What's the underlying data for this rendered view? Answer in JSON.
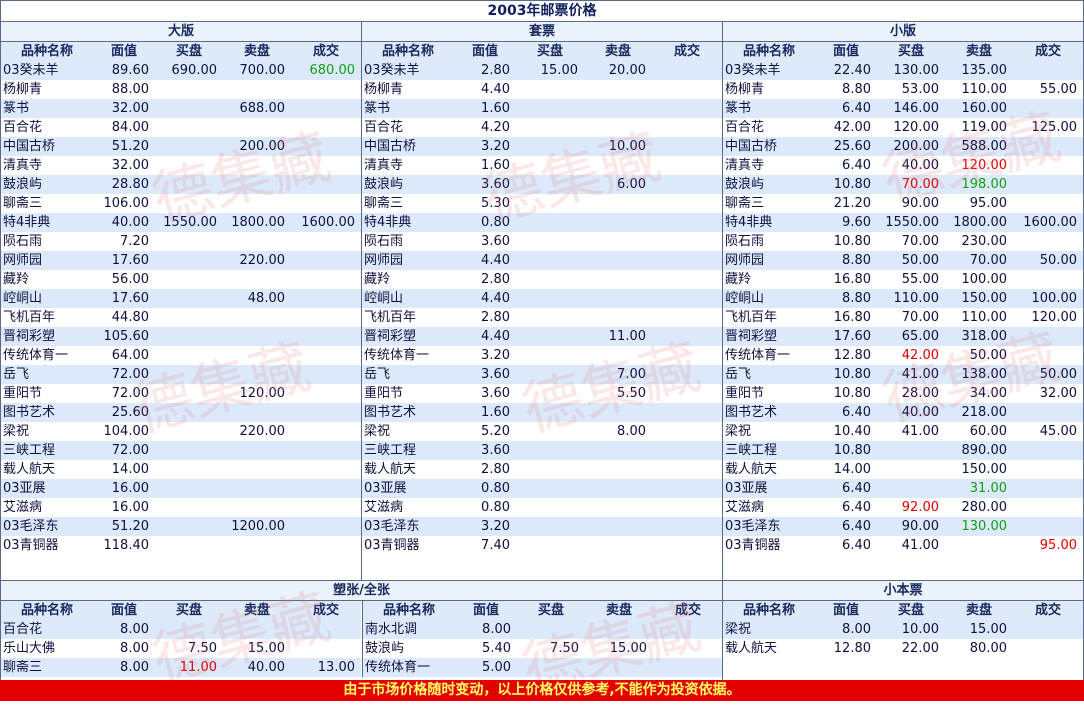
{
  "title": "2003年邮票价格",
  "columns": [
    "品种名称",
    "面值",
    "买盘",
    "卖盘",
    "成交"
  ],
  "panels": {
    "dab": {
      "title": "大版",
      "rows": [
        [
          "03癸未羊",
          "89.60",
          "690.00",
          "700.00",
          "680.00"
        ],
        [
          "杨柳青",
          "88.00",
          "",
          "",
          ""
        ],
        [
          "篆书",
          "32.00",
          "",
          "688.00",
          ""
        ],
        [
          "百合花",
          "84.00",
          "",
          "",
          ""
        ],
        [
          "中国古桥",
          "51.20",
          "",
          "200.00",
          ""
        ],
        [
          "清真寺",
          "32.00",
          "",
          "",
          ""
        ],
        [
          "鼓浪屿",
          "28.80",
          "",
          "",
          ""
        ],
        [
          "聊斋三",
          "106.00",
          "",
          "",
          ""
        ],
        [
          "特4非典",
          "40.00",
          "1550.00",
          "1800.00",
          "1600.00"
        ],
        [
          "陨石雨",
          "7.20",
          "",
          "",
          ""
        ],
        [
          "网师园",
          "17.60",
          "",
          "220.00",
          ""
        ],
        [
          "藏羚",
          "56.00",
          "",
          "",
          ""
        ],
        [
          "崆峒山",
          "17.60",
          "",
          "48.00",
          ""
        ],
        [
          "飞机百年",
          "44.80",
          "",
          "",
          ""
        ],
        [
          "晋祠彩塑",
          "105.60",
          "",
          "",
          ""
        ],
        [
          "传统体育一",
          "64.00",
          "",
          "",
          ""
        ],
        [
          "岳飞",
          "72.00",
          "",
          "",
          ""
        ],
        [
          "重阳节",
          "72.00",
          "",
          "120.00",
          ""
        ],
        [
          "图书艺术",
          "25.60",
          "",
          "",
          ""
        ],
        [
          "梁祝",
          "104.00",
          "",
          "220.00",
          ""
        ],
        [
          "三峡工程",
          "72.00",
          "",
          "",
          ""
        ],
        [
          "载人航天",
          "14.00",
          "",
          "",
          ""
        ],
        [
          "03亚展",
          "16.00",
          "",
          "",
          ""
        ],
        [
          "艾滋病",
          "16.00",
          "",
          "",
          ""
        ],
        [
          "03毛泽东",
          "51.20",
          "",
          "1200.00",
          ""
        ],
        [
          "03青铜器",
          "118.40",
          "",
          "",
          ""
        ]
      ]
    },
    "taopiao": {
      "title": "套票",
      "rows": [
        [
          "03癸未羊",
          "2.80",
          "15.00",
          "20.00",
          ""
        ],
        [
          "杨柳青",
          "4.40",
          "",
          "",
          ""
        ],
        [
          "篆书",
          "1.60",
          "",
          "",
          ""
        ],
        [
          "百合花",
          "4.20",
          "",
          "",
          ""
        ],
        [
          "中国古桥",
          "3.20",
          "",
          "10.00",
          ""
        ],
        [
          "清真寺",
          "1.60",
          "",
          "",
          ""
        ],
        [
          "鼓浪屿",
          "3.60",
          "",
          "6.00",
          ""
        ],
        [
          "聊斋三",
          "5.30",
          "",
          "",
          ""
        ],
        [
          "特4非典",
          "0.80",
          "",
          "",
          ""
        ],
        [
          "陨石雨",
          "3.60",
          "",
          "",
          ""
        ],
        [
          "网师园",
          "4.40",
          "",
          "",
          ""
        ],
        [
          "藏羚",
          "2.80",
          "",
          "",
          ""
        ],
        [
          "崆峒山",
          "4.40",
          "",
          "",
          ""
        ],
        [
          "飞机百年",
          "2.80",
          "",
          "",
          ""
        ],
        [
          "晋祠彩塑",
          "4.40",
          "",
          "11.00",
          ""
        ],
        [
          "传统体育一",
          "3.20",
          "",
          "",
          ""
        ],
        [
          "岳飞",
          "3.60",
          "",
          "7.00",
          ""
        ],
        [
          "重阳节",
          "3.60",
          "",
          "5.50",
          ""
        ],
        [
          "图书艺术",
          "1.60",
          "",
          "",
          ""
        ],
        [
          "梁祝",
          "5.20",
          "",
          "8.00",
          ""
        ],
        [
          "三峡工程",
          "3.60",
          "",
          "",
          ""
        ],
        [
          "载人航天",
          "2.80",
          "",
          "",
          ""
        ],
        [
          "03亚展",
          "0.80",
          "",
          "",
          ""
        ],
        [
          "艾滋病",
          "0.80",
          "",
          "",
          ""
        ],
        [
          "03毛泽东",
          "3.20",
          "",
          "",
          ""
        ],
        [
          "03青铜器",
          "7.40",
          "",
          "",
          ""
        ]
      ]
    },
    "xiaob": {
      "title": "小版",
      "rows": [
        [
          "03癸未羊",
          "22.40",
          "130.00",
          "135.00",
          ""
        ],
        [
          "杨柳青",
          "8.80",
          "53.00",
          "110.00",
          "55.00"
        ],
        [
          "篆书",
          "6.40",
          "146.00",
          "160.00",
          ""
        ],
        [
          "百合花",
          "42.00",
          "120.00",
          "119.00",
          "125.00"
        ],
        [
          "中国古桥",
          "25.60",
          "200.00",
          "588.00",
          ""
        ],
        [
          "清真寺",
          "6.40",
          "40.00",
          "120.00",
          ""
        ],
        [
          "鼓浪屿",
          "10.80",
          "70.00",
          "198.00",
          ""
        ],
        [
          "聊斋三",
          "21.20",
          "90.00",
          "95.00",
          ""
        ],
        [
          "特4非典",
          "9.60",
          "1550.00",
          "1800.00",
          "1600.00"
        ],
        [
          "陨石雨",
          "10.80",
          "70.00",
          "230.00",
          ""
        ],
        [
          "网师园",
          "8.80",
          "50.00",
          "70.00",
          "50.00"
        ],
        [
          "藏羚",
          "16.80",
          "55.00",
          "100.00",
          ""
        ],
        [
          "崆峒山",
          "8.80",
          "110.00",
          "150.00",
          "100.00"
        ],
        [
          "飞机百年",
          "16.80",
          "70.00",
          "110.00",
          "120.00"
        ],
        [
          "晋祠彩塑",
          "17.60",
          "65.00",
          "318.00",
          ""
        ],
        [
          "传统体育一",
          "12.80",
          "42.00",
          "50.00",
          ""
        ],
        [
          "岳飞",
          "10.80",
          "41.00",
          "138.00",
          "50.00"
        ],
        [
          "重阳节",
          "10.80",
          "28.00",
          "34.00",
          "32.00"
        ],
        [
          "图书艺术",
          "6.40",
          "40.00",
          "218.00",
          ""
        ],
        [
          "梁祝",
          "10.40",
          "41.00",
          "60.00",
          "45.00"
        ],
        [
          "三峡工程",
          "10.80",
          "",
          "890.00",
          ""
        ],
        [
          "载人航天",
          "14.00",
          "",
          "150.00",
          ""
        ],
        [
          "03亚展",
          "6.40",
          "",
          "31.00",
          ""
        ],
        [
          "艾滋病",
          "6.40",
          "92.00",
          "280.00",
          ""
        ],
        [
          "03毛泽东",
          "6.40",
          "90.00",
          "130.00",
          ""
        ],
        [
          "03青铜器",
          "6.40",
          "41.00",
          "",
          "95.00"
        ]
      ]
    },
    "suzhang": {
      "title": "塑张/全张",
      "rows": [
        [
          "百合花",
          "8.00",
          "",
          "",
          ""
        ],
        [
          "乐山大佛",
          "8.00",
          "7.50",
          "15.00",
          ""
        ],
        [
          "聊斋三",
          "8.00",
          "11.00",
          "40.00",
          "13.00"
        ]
      ]
    },
    "suzhang2": {
      "rows": [
        [
          "南水北调",
          "8.00",
          "",
          "",
          ""
        ],
        [
          "鼓浪屿",
          "5.40",
          "7.50",
          "15.00",
          ""
        ],
        [
          "传统体育一",
          "5.00",
          "",
          "",
          ""
        ]
      ]
    },
    "xiaoben": {
      "title": "小本票",
      "rows": [
        [
          "梁祝",
          "8.00",
          "10.00",
          "15.00",
          ""
        ],
        [
          "载人航天",
          "12.80",
          "22.00",
          "80.00",
          ""
        ]
      ]
    }
  },
  "highlights": {
    "dab": {
      "0-4": "green"
    },
    "xiaob": {
      "5-3": "red",
      "6-2": "red",
      "6-3": "green",
      "15-2": "red",
      "22-3": "green",
      "23-2": "red",
      "24-3": "green",
      "25-4": "red"
    },
    "suzhang": {
      "2-2": "red"
    }
  },
  "watermark": "德集藏",
  "footer": "由于市场价格随时变动，以上价格仅供参考,不能作为投资依据。"
}
